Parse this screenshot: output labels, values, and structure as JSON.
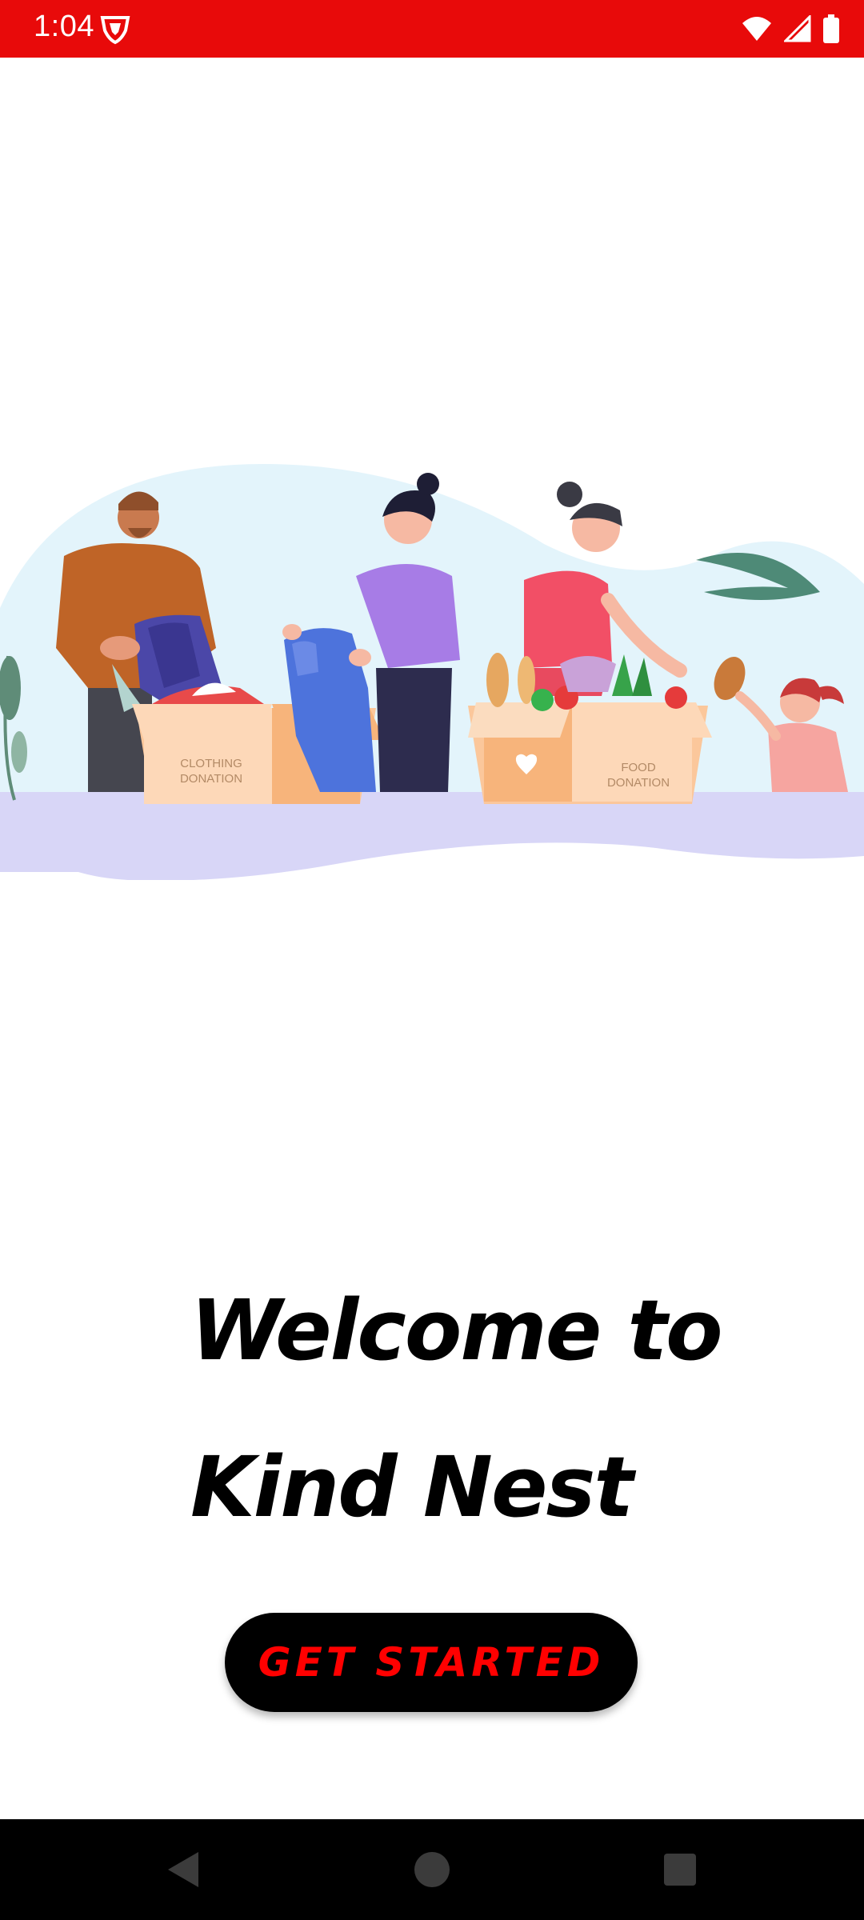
{
  "status_bar": {
    "time": "1:04",
    "icons": [
      "shield-icon",
      "wifi-icon",
      "cell-signal-icon",
      "battery-icon"
    ],
    "background": "#e80a0a"
  },
  "illustration": {
    "box_left_label_line1": "CLOTHING",
    "box_left_label_line2": "DONATION",
    "box_right_label_line1": "FOOD",
    "box_right_label_line2": "DONATION"
  },
  "welcome": {
    "line1": "Welcome to",
    "line2": "Kind Nest"
  },
  "cta": {
    "label": "GET STARTED",
    "text_color": "#ff0000",
    "background": "#000000"
  },
  "nav_bar": {
    "icons": [
      "back-icon",
      "home-icon",
      "recents-icon"
    ]
  }
}
